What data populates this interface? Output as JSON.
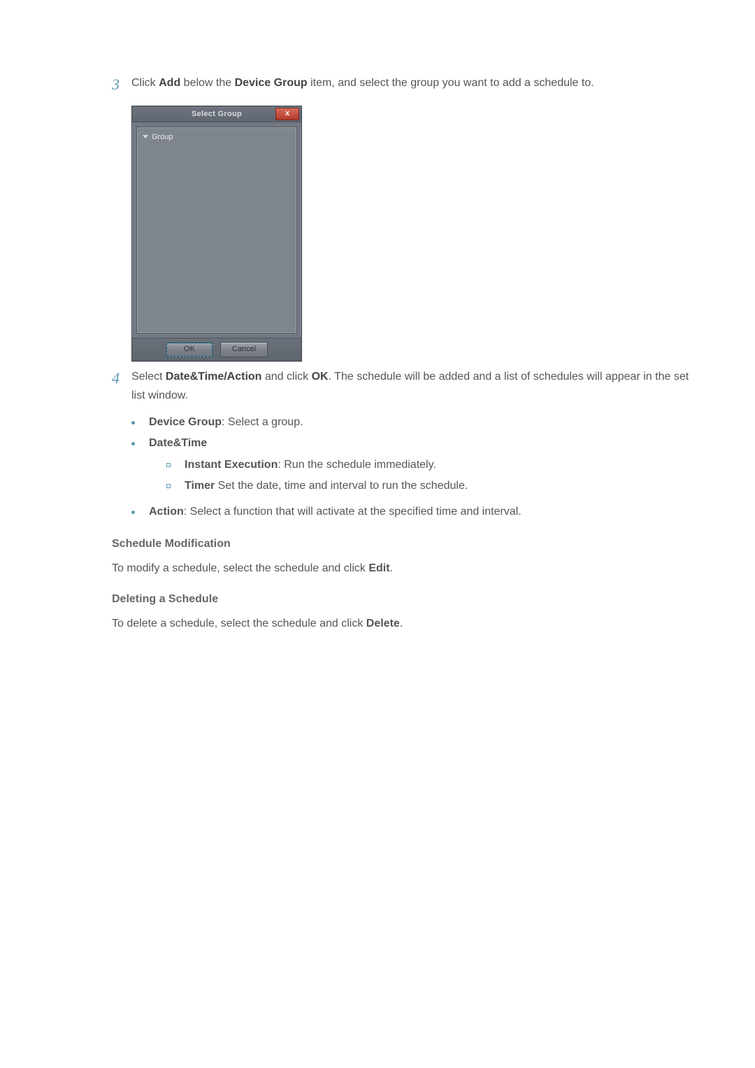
{
  "step3": {
    "number": "3",
    "text_pre": "Click ",
    "b1": "Add",
    "text_mid": " below the ",
    "b2": "Device Group",
    "text_post": " item, and select the group you want to add a schedule to."
  },
  "dialog": {
    "title": "Select Group",
    "close_label": "x",
    "tree_item": "Group",
    "ok_label": "OK",
    "cancel_label": "Cancel"
  },
  "step4": {
    "number": "4",
    "text_pre": "Select ",
    "b1": "Date&Time/Action",
    "text_mid": " and click ",
    "b2": "OK",
    "text_post": ". The schedule will be added and a list of schedules will appear in the set list window."
  },
  "bullets": {
    "device_group_b": "Device Group",
    "device_group_rest": ": Select a group.",
    "datetime_b": "Date&Time",
    "instant_b": "Instant Execution",
    "instant_rest": ": Run the schedule immediately.",
    "timer_b": "Timer",
    "timer_rest": " Set the date, time and interval to run the schedule.",
    "action_b": "Action",
    "action_rest": ": Select a function that will activate at the specified time and interval."
  },
  "schedule_mod": {
    "heading": "Schedule Modification",
    "para_pre": "To modify a schedule, select the schedule and click ",
    "para_b": "Edit",
    "para_post": "."
  },
  "deleting": {
    "heading": "Deleting a Schedule",
    "para_pre": "To delete a schedule, select the schedule and click ",
    "para_b": "Delete",
    "para_post": "."
  }
}
